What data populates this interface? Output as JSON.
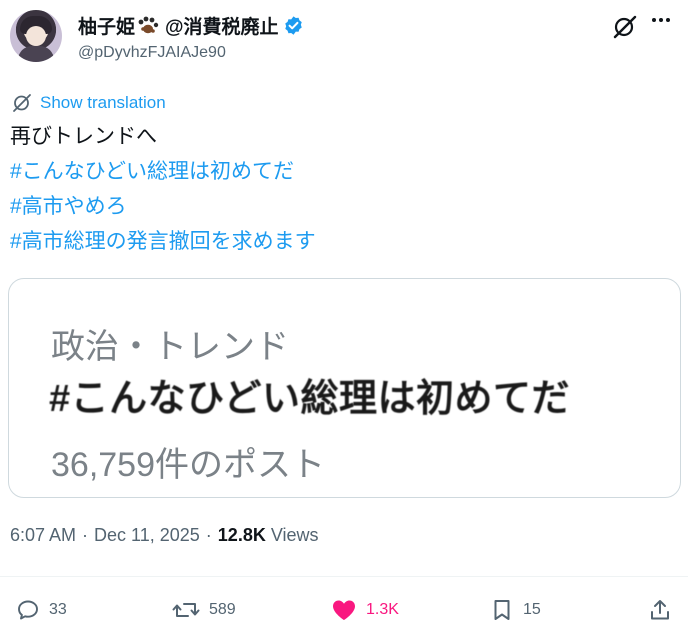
{
  "author": {
    "display_name": "柚子姫",
    "name_suffix": "@消費税廃止",
    "handle": "@pDyvhzFJAIAJe90",
    "verified": true,
    "verified_color": "#1d9bf0"
  },
  "translation_link": "Show translation",
  "tweet": {
    "lines": [
      {
        "text": "再びトレンドへ",
        "hashtag": false
      },
      {
        "text": "#こんなひどい総理は初めてだ",
        "hashtag": true
      },
      {
        "text": "#高市やめろ",
        "hashtag": true
      },
      {
        "text": "#高市総理の発言撤回を求めます",
        "hashtag": true
      }
    ]
  },
  "card": {
    "category": "政治・トレンド",
    "title": "#こんなひどい総理は初めてだ",
    "count": "36,759件のポスト"
  },
  "meta": {
    "time": "6:07 AM",
    "date": "Dec 11, 2025",
    "views_count": "12.8K",
    "views_label": "Views",
    "separator": "·"
  },
  "actions": {
    "replies": "33",
    "reposts": "589",
    "likes": "1.3K",
    "bookmarks": "15"
  },
  "colors": {
    "link": "#1d9bf0",
    "like": "#f91880",
    "secondary_text": "#536471"
  }
}
